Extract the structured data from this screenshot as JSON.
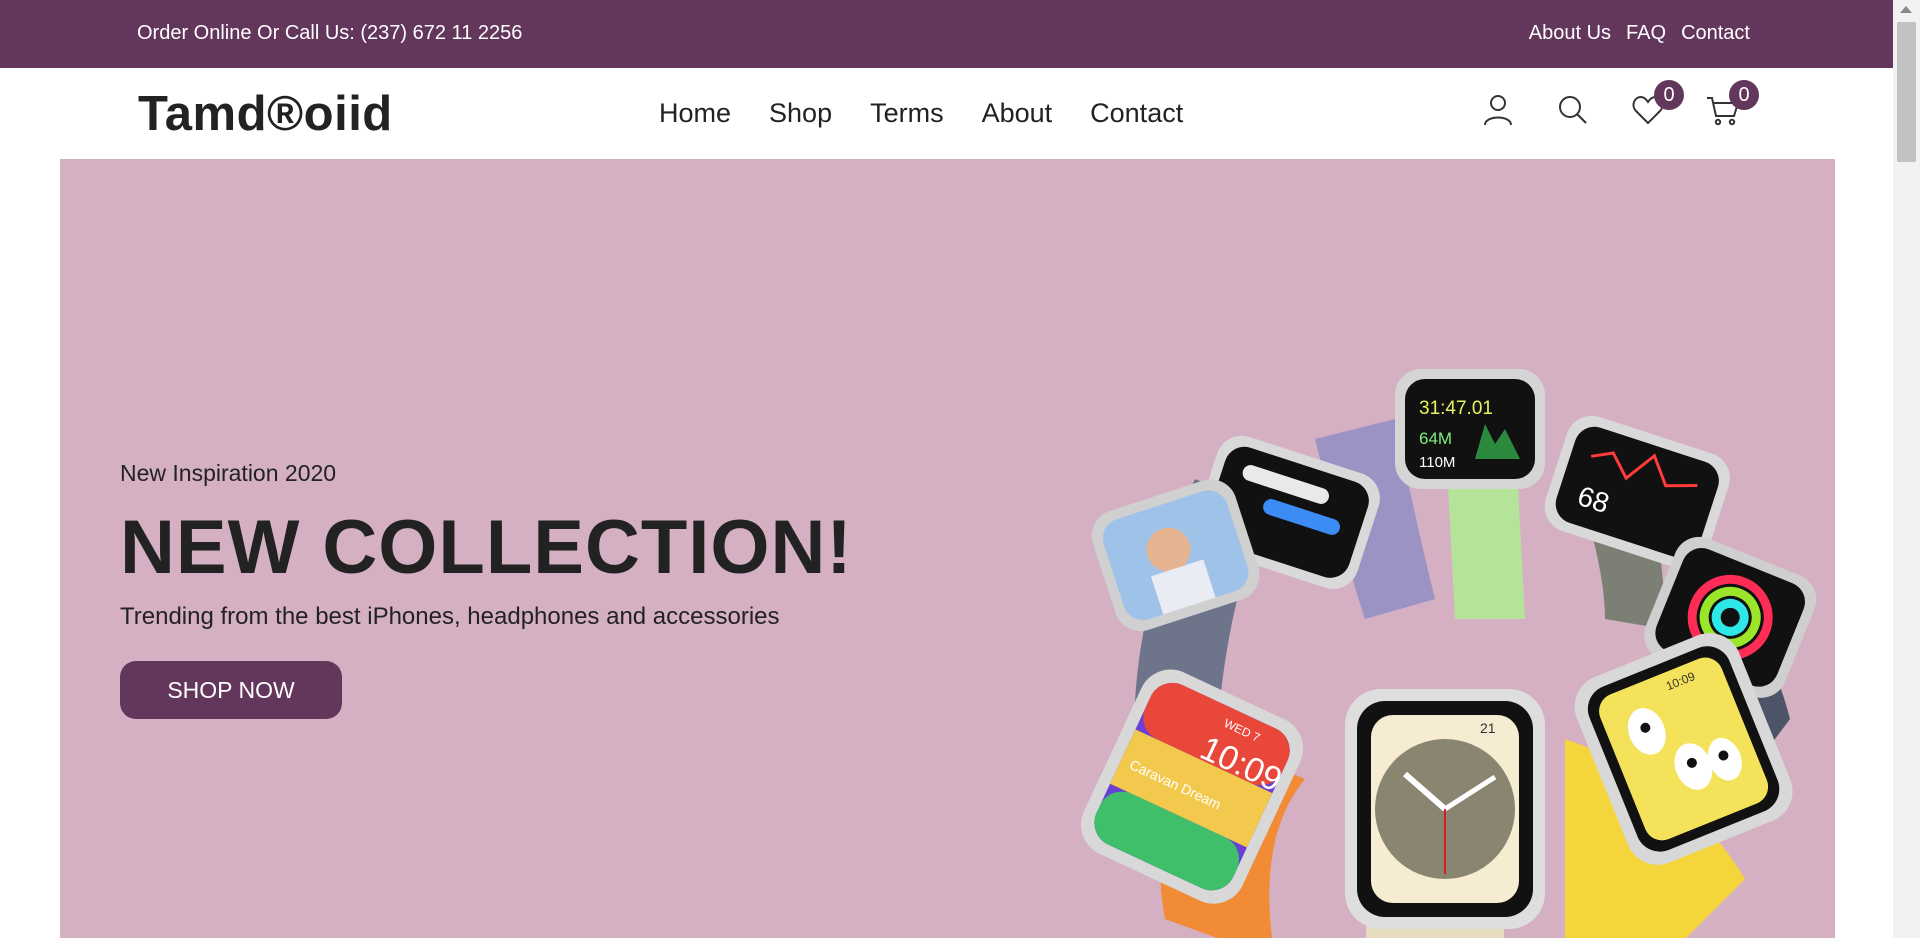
{
  "topbar": {
    "contact_text": "Order Online Or Call Us: (237) 672 11 2256",
    "links": [
      "About Us",
      "FAQ",
      "Contact"
    ]
  },
  "header": {
    "logo": "Tamd®oiid",
    "nav": [
      "Home",
      "Shop",
      "Terms",
      "About",
      "Contact"
    ],
    "icons": [
      "user-icon",
      "search-icon",
      "heart-icon",
      "cart-icon"
    ],
    "wishlist_count": "0",
    "cart_count": "0"
  },
  "hero": {
    "subtitle": "New Inspiration 2020",
    "headline": "NEW COLLECTION!",
    "tagline": "Trending from the best iPhones, headphones and accessories",
    "cta_label": "SHOP NOW",
    "watch_faces": {
      "timer": "31:47.01",
      "elev_gained": "64M",
      "elev": "110M",
      "heart_rate": "68",
      "clock_digital": "10:09",
      "complication_text": "Caravan Dream",
      "date": "WED 7",
      "dial_day": "21",
      "small_time": "10:09"
    }
  },
  "colors": {
    "brand": "#63365c",
    "hero_bg": "#d4b0c2"
  }
}
